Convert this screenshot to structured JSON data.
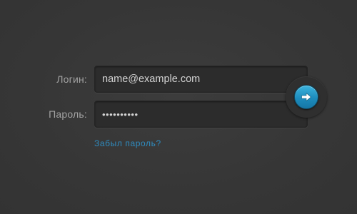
{
  "form": {
    "login_label": "Логин:",
    "login_value": "name@example.com",
    "password_label": "Пароль:",
    "password_value": "••••••••••",
    "forgot_link": "Забыл пароль?",
    "submit_icon": "arrow-right-icon"
  },
  "colors": {
    "background": "#383838",
    "accent": "#1d8cbd",
    "link": "#2f8cc0",
    "label": "#a3a3a3"
  }
}
